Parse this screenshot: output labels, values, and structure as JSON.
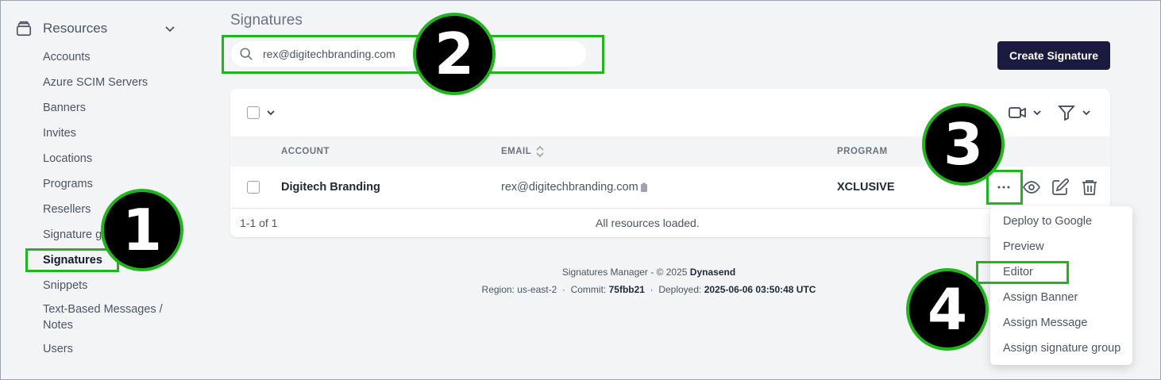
{
  "sidebar": {
    "section_label": "Resources",
    "items": [
      {
        "label": "Accounts"
      },
      {
        "label": "Azure SCIM Servers"
      },
      {
        "label": "Banners"
      },
      {
        "label": "Invites"
      },
      {
        "label": "Locations"
      },
      {
        "label": "Programs"
      },
      {
        "label": "Resellers"
      },
      {
        "label": "Signature g"
      },
      {
        "label": "Signatures"
      },
      {
        "label": "Snippets"
      },
      {
        "label": "Text-Based Messages /"
      },
      {
        "label": "Notes"
      },
      {
        "label": "Users"
      }
    ]
  },
  "page": {
    "title": "Signatures",
    "search_value": "rex@digitechbranding.com",
    "create_button": "Create Signature"
  },
  "table": {
    "headers": {
      "account": "ACCOUNT",
      "email": "EMAIL",
      "program": "PROGRAM"
    },
    "rows": [
      {
        "account": "Digitech Branding",
        "email": "rex@digitechbranding.com",
        "program": "XCLUSIVE"
      }
    ],
    "pagination": "1-1 of 1",
    "status": "All resources loaded."
  },
  "footer": {
    "line1_prefix": "Signatures Manager - © 2025",
    "line1_brand": "Dynasend",
    "region_label": "Region: us-east-2",
    "sep": "·",
    "commit_label": "Commit:",
    "commit_value": "75fbb21",
    "deployed_label": "Deployed:",
    "deployed_value": "2025-06-06 03:50:48 UTC"
  },
  "menu": {
    "items": [
      {
        "label": "Deploy to Google"
      },
      {
        "label": "Preview"
      },
      {
        "label": "Editor"
      },
      {
        "label": "Assign Banner"
      },
      {
        "label": "Assign Message"
      },
      {
        "label": "Assign signature group"
      }
    ]
  },
  "annotations": {
    "step1": "1",
    "step2": "2",
    "step3": "3",
    "step4": "4",
    "highlight_color": "#22b41d"
  },
  "icons": {
    "resources": "stack-icon",
    "search": "search-icon",
    "video": "video-icon",
    "filter": "filter-icon",
    "more": "more-horizontal-icon",
    "view": "eye-icon",
    "edit": "edit-icon",
    "delete": "trash-icon",
    "copy": "clipboard-icon"
  }
}
